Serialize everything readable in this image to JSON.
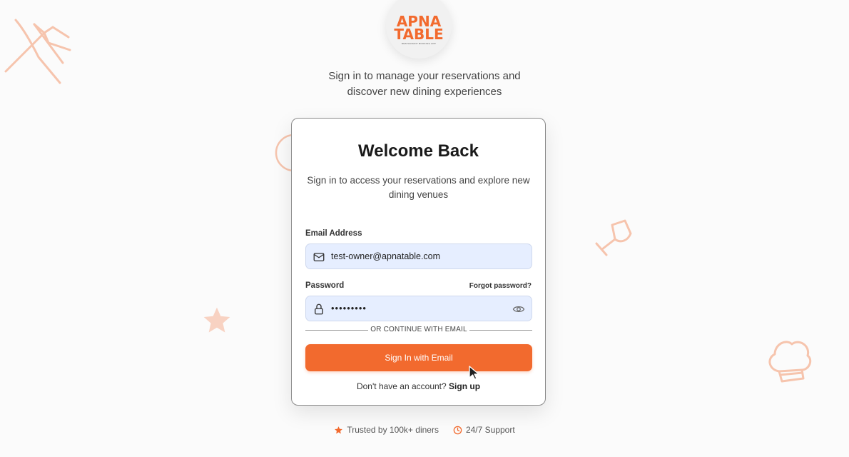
{
  "brand": {
    "line1": "APNA",
    "line2": "TABLE",
    "tagline_small": "RESTAURANT BOOKING APP"
  },
  "tagline": {
    "line1": "Sign in to manage your reservations and",
    "line2": "discover new dining experiences"
  },
  "card": {
    "title": "Welcome Back",
    "subtitle_line1": "Sign in to access your reservations and explore new",
    "subtitle_line2": "dining venues",
    "email": {
      "label": "Email Address",
      "value": "test-owner@apnatable.com"
    },
    "password": {
      "label": "Password",
      "value": "•••••••••",
      "forgot_label": "Forgot password?"
    },
    "divider_text": "OR CONTINUE WITH EMAIL",
    "signin_button": "Sign In with Email",
    "signup_prompt": "Don't have an account?",
    "signup_link": "Sign up"
  },
  "footer": {
    "trusted": "Trusted by 100k+ diners",
    "support": "24/7 Support"
  },
  "colors": {
    "accent": "#f26a2e",
    "field_bg": "#e6eeff"
  }
}
